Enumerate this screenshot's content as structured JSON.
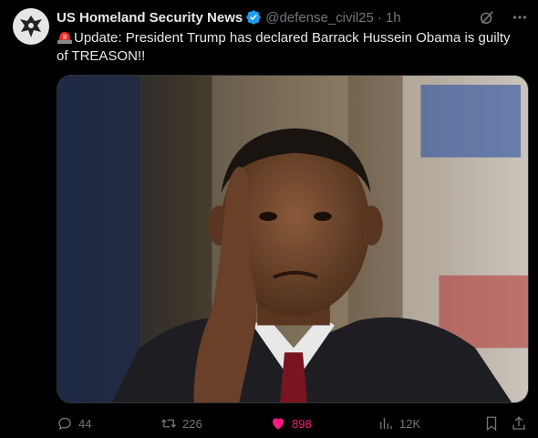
{
  "post": {
    "author_name": "US Homeland Security News",
    "author_handle": "@defense_civil25",
    "separator": "·",
    "time": "1h",
    "text": "Update: President Trump has declared Barrack Hussein Obama is guilty of TREASON!!",
    "media_description_icon": "photo"
  },
  "actions": {
    "replies": "44",
    "reposts": "226",
    "likes": "898",
    "views": "12K"
  },
  "colors": {
    "background": "#000000",
    "text": "#e7e9ea",
    "muted": "#71767b",
    "like": "#f91880",
    "verified": "#1d9bf0"
  }
}
